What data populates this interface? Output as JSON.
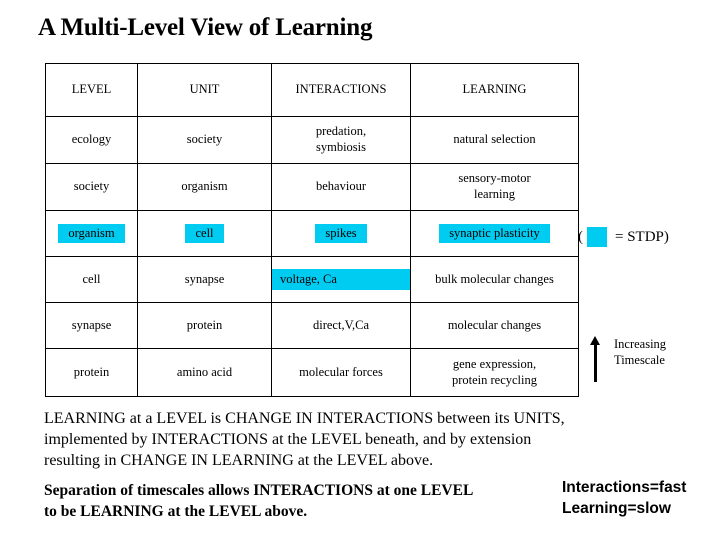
{
  "title": "A Multi-Level View of Learning",
  "colors": {
    "highlight": "#00CCF2",
    "text": "#000000",
    "background": "#ffffff",
    "border": "#000000"
  },
  "table": {
    "headers": [
      "LEVEL",
      "UNIT",
      "INTERACTIONS",
      "LEARNING"
    ],
    "rows": [
      {
        "level": "ecology",
        "unit": "society",
        "interactions_line1": "predation,",
        "interactions_line2": "symbiosis",
        "learning": "natural selection",
        "highlighted": []
      },
      {
        "level": "society",
        "unit": "organism",
        "interactions": "behaviour",
        "learning_line1": "sensory-motor",
        "learning_line2": "learning",
        "highlighted": []
      },
      {
        "level": "organism",
        "unit": "cell",
        "interactions": "spikes",
        "learning": "synaptic  plasticity",
        "highlighted": [
          "level",
          "unit",
          "interactions",
          "learning"
        ]
      },
      {
        "level": "cell",
        "unit": "synapse",
        "interactions": "voltage, Ca",
        "learning": "bulk molecular changes",
        "highlighted": [
          "interactions"
        ]
      },
      {
        "level": "synapse",
        "unit": "protein",
        "interactions": "direct,V,Ca",
        "learning": "molecular changes",
        "highlighted": []
      },
      {
        "level": "protein",
        "unit": "amino acid",
        "interactions": "molecular forces",
        "learning_line1": "gene expression,",
        "learning_line2": "protein recycling",
        "highlighted": []
      }
    ]
  },
  "legend": {
    "open_paren": "(",
    "equals_label": "= STDP)"
  },
  "timescale": {
    "line1": "Increasing",
    "line2": "Timescale"
  },
  "paragraphs": {
    "main_line1": "LEARNING at a LEVEL is CHANGE IN INTERACTIONS between its UNITS,",
    "main_line2": "implemented by INTERACTIONS at the LEVEL beneath, and by extension",
    "main_line3": "resulting in CHANGE IN LEARNING at the LEVEL above.",
    "secondary_line1": "Separation of timescales allows INTERACTIONS at one LEVEL",
    "secondary_line2": "to be LEARNING at the LEVEL above."
  },
  "speed_note": {
    "line1": "Interactions=fast",
    "line2": "Learning=slow"
  }
}
